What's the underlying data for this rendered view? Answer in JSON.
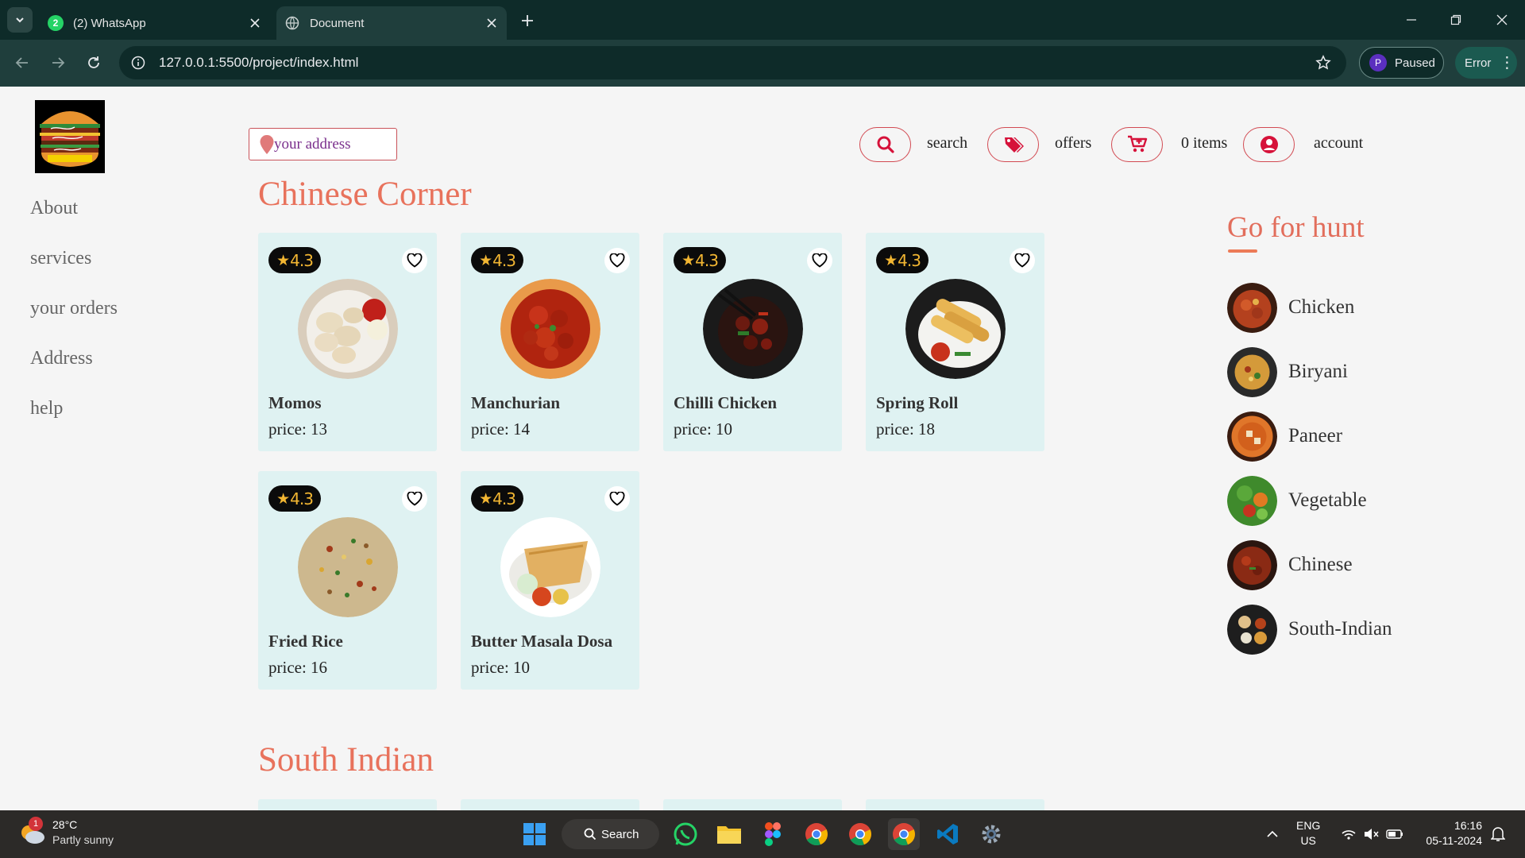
{
  "browser": {
    "tabs": [
      {
        "title": "(2) WhatsApp",
        "badge": "2"
      },
      {
        "title": "Document"
      }
    ],
    "url": "127.0.0.1:5500/project/index.html",
    "profile": {
      "initial": "P",
      "label": "Paused"
    },
    "error_label": "Error"
  },
  "sidenav": [
    "About",
    "services",
    "your orders",
    "Address",
    "help"
  ],
  "header": {
    "address_placeholder": "your address",
    "search_label": "search",
    "offers_label": "offers",
    "cart_label": "0 items",
    "account_label": "account"
  },
  "sections": {
    "chinese_title": "Chinese Corner",
    "south_title": "South Indian"
  },
  "dishes": [
    {
      "rating": "4.3",
      "name": "Momos",
      "price": "price: 13"
    },
    {
      "rating": "4.3",
      "name": "Manchurian",
      "price": "price: 14"
    },
    {
      "rating": "4.3",
      "name": "Chilli Chicken",
      "price": "price: 10"
    },
    {
      "rating": "4.3",
      "name": "Spring Roll",
      "price": "price: 18"
    },
    {
      "rating": "4.3",
      "name": "Fried Rice",
      "price": "price: 16"
    },
    {
      "rating": "4.3",
      "name": "Butter Masala Dosa",
      "price": "price: 10"
    }
  ],
  "hunt": {
    "title": "Go for hunt",
    "items": [
      "Chicken",
      "Biryani",
      "Paneer",
      "Vegetable",
      "Chinese",
      "South-Indian"
    ]
  },
  "taskbar": {
    "weather_temp": "28°C",
    "weather_desc": "Partly sunny",
    "weather_badge": "1",
    "search_label": "Search",
    "lang_1": "ENG",
    "lang_2": "US",
    "time": "16:16",
    "date": "05-11-2024"
  },
  "colors": {
    "accent": "#e8725c",
    "card_bg": "#dff2f2",
    "icon_red": "#d6123a"
  }
}
